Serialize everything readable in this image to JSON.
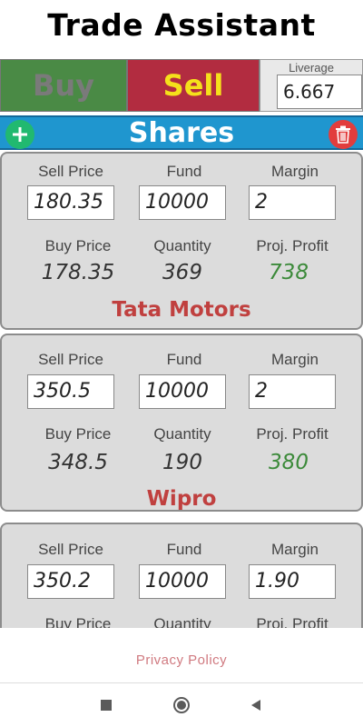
{
  "app": {
    "title": "Trade Assistant"
  },
  "mode": {
    "buy_label": "Buy",
    "sell_label": "Sell",
    "selected": "Sell"
  },
  "leverage": {
    "label": "Liverage",
    "value": "6.667"
  },
  "section": {
    "title": "Shares",
    "add_icon": "plus-icon",
    "delete_icon": "trash-icon"
  },
  "labels": {
    "sell_price": "Sell Price",
    "fund": "Fund",
    "margin": "Margin",
    "buy_price": "Buy Price",
    "quantity": "Quantity",
    "proj_profit": "Proj. Profit"
  },
  "cards": [
    {
      "sell_price": "180.35",
      "fund": "10000",
      "margin": "2",
      "buy_price": "178.35",
      "quantity": "369",
      "proj_profit": "738",
      "name": "Tata Motors"
    },
    {
      "sell_price": "350.5",
      "fund": "10000",
      "margin": "2",
      "buy_price": "348.5",
      "quantity": "190",
      "proj_profit": "380",
      "name": "Wipro"
    },
    {
      "sell_price": "350.2",
      "fund": "10000",
      "margin": "1.90",
      "buy_price": "",
      "quantity": "",
      "proj_profit": "",
      "name": ""
    }
  ],
  "footer": {
    "privacy_policy": "Privacy Policy"
  },
  "colors": {
    "buy": "#4a8a45",
    "sell": "#b22c40",
    "sell_text": "#f5e11b",
    "shares_bar": "#1f96cf",
    "profit": "#3c8a3a",
    "stock_name": "#c0403f"
  }
}
